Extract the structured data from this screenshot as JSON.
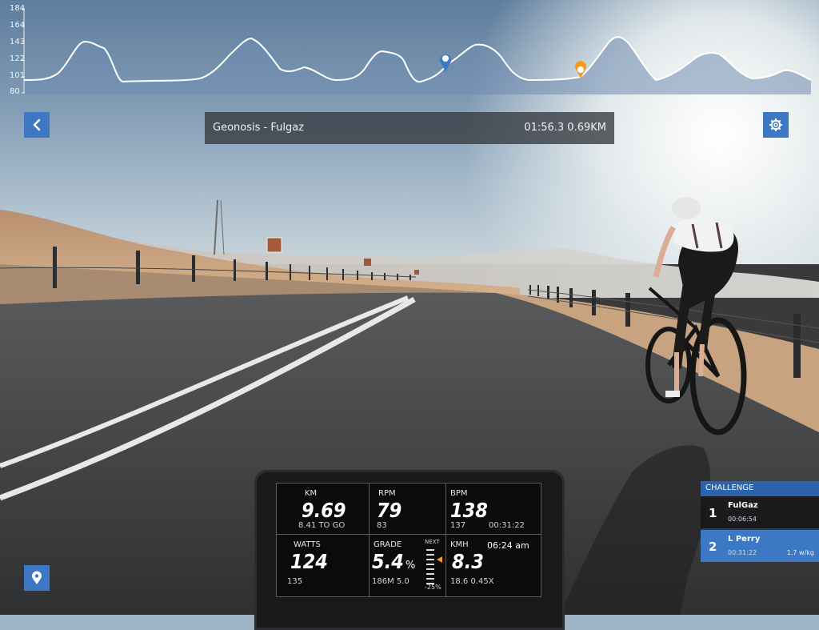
{
  "elevation": {
    "y_labels": [
      "184",
      "164",
      "143",
      "122",
      "101",
      "80"
    ],
    "line_color": "#ffffff",
    "fill_color": "#6f8db0",
    "current_marker_color": "#3c78c3",
    "rival_marker_color": "#f39a1f"
  },
  "header": {
    "title": "Geonosis - Fulgaz",
    "status": "01:56.3 0.69KM"
  },
  "icons": {
    "back": "chevron-left-icon",
    "settings": "gear-icon",
    "map": "map-pin-icon"
  },
  "computer": {
    "km": {
      "label": "KM",
      "value": "9.69",
      "sub": "8.41 TO GO"
    },
    "rpm": {
      "label": "RPM",
      "value": "79",
      "sub": "83"
    },
    "bpm": {
      "label": "BPM",
      "value": "138",
      "sub": "137",
      "time": "00:31:22"
    },
    "watts": {
      "label": "WATTS",
      "value": "124",
      "sub": "135"
    },
    "grade": {
      "label": "GRADE",
      "value": "5.4",
      "unit": "%",
      "sub": "186M 5.0"
    },
    "next": {
      "label": "NEXT",
      "sub": "-25%"
    },
    "kmh": {
      "label": "KMH",
      "clock": "06:24 am",
      "value": "8.3",
      "sub": "18.6 0.45X"
    }
  },
  "challenge": {
    "title": "CHALLENGE",
    "rows": [
      {
        "rank": "1",
        "name": "FulGaz",
        "time": "00:06:54",
        "extra": ""
      },
      {
        "rank": "2",
        "name": "L Perry",
        "time": "00:31:22",
        "extra": "1.7 w/kg"
      }
    ]
  },
  "colors": {
    "accent": "#3c78c3",
    "panel": "#34383f"
  }
}
